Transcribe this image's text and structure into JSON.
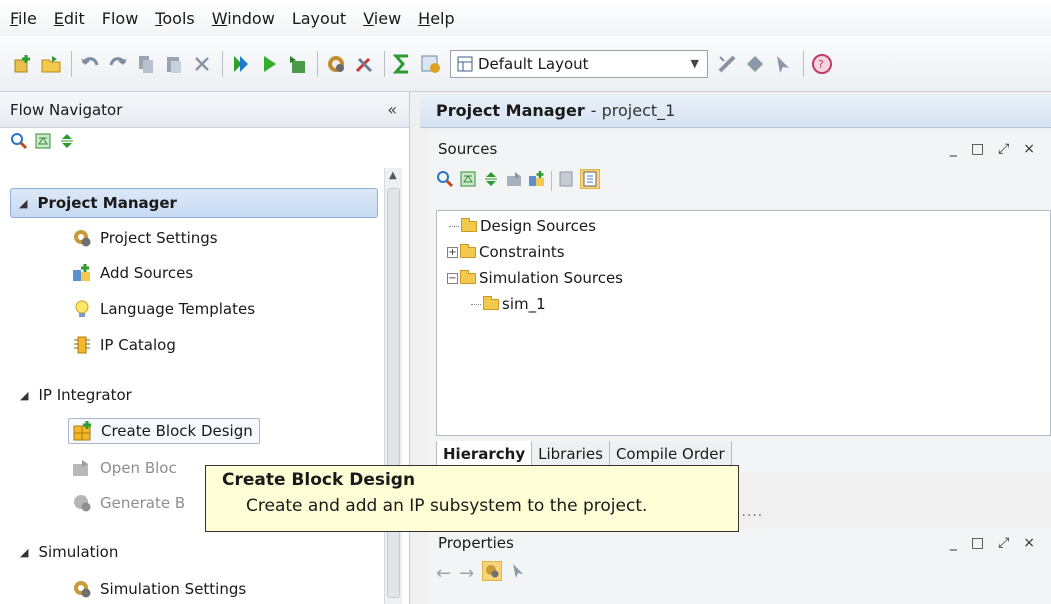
{
  "menu": [
    {
      "label": "File",
      "u": "F",
      "rest": "ile"
    },
    {
      "label": "Edit",
      "u": "E",
      "rest": "dit"
    },
    {
      "label": "Flow",
      "u": "",
      "rest": "Flow"
    },
    {
      "label": "Tools",
      "u": "T",
      "rest": "ools"
    },
    {
      "label": "Window",
      "u": "W",
      "rest": "indow"
    },
    {
      "label": "Layout",
      "u": "",
      "rest": "Layout"
    },
    {
      "label": "View",
      "u": "V",
      "rest": "iew"
    },
    {
      "label": "Help",
      "u": "H",
      "rest": "elp"
    }
  ],
  "toolbar": {
    "layout_value": "Default Layout"
  },
  "flow_nav": {
    "title": "Flow Navigator",
    "collapse": "«",
    "project_manager": "Project Manager",
    "project_settings": "Project Settings",
    "add_sources": "Add Sources",
    "language_templates": "Language Templates",
    "ip_catalog": "IP Catalog",
    "ip_integrator": "IP Integrator",
    "create_block_design": "Create Block Design",
    "open_block": "Open Bloc",
    "generate": "Generate B",
    "simulation": "Simulation",
    "simulation_settings": "Simulation Settings"
  },
  "main": {
    "title_bold": "Project Manager",
    "title_sub": "- project_1",
    "sources_title": "Sources",
    "tree": {
      "design_sources": "Design Sources",
      "constraints": "Constraints",
      "simulation_sources": "Simulation Sources",
      "sim_1": "sim_1"
    },
    "tabs": [
      "Hierarchy",
      "Libraries",
      "Compile Order"
    ],
    "properties_title": "Properties",
    "dots": "....."
  },
  "tooltip": {
    "title": "Create Block Design",
    "description": "Create and add an IP subsystem to the project."
  },
  "colors": {
    "selection": "#c7daf2",
    "tooltip_bg": "#fffdd6",
    "folder": "#f2c94c"
  }
}
